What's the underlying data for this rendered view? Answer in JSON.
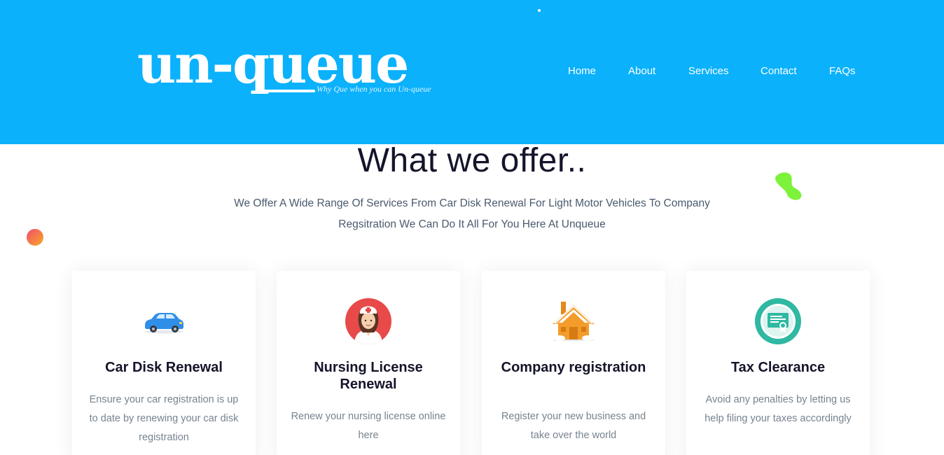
{
  "header": {
    "logo": {
      "text": "un-queue",
      "tagline": "Why Que when you can Un-queue"
    },
    "nav": [
      "Home",
      "About",
      "Services",
      "Contact",
      "FAQs"
    ]
  },
  "section": {
    "title": "What we offer..",
    "intro": "We Offer A Wide Range Of Services From Car Disk Renewal For Light Motor Vehicles To Company Regsitration We Can Do It All For You Here At Unqueue"
  },
  "services": [
    {
      "icon": "car-icon",
      "title": "Car Disk Renewal",
      "description": "Ensure your car registration is up to date by renewing your car disk registration"
    },
    {
      "icon": "nurse-icon",
      "title": "Nursing License Renewal",
      "description": "Renew your nursing license online here"
    },
    {
      "icon": "house-icon",
      "title": "Company registration",
      "description": "Register your new business and take over the world"
    },
    {
      "icon": "certificate-icon",
      "title": "Tax Clearance",
      "description": "Avoid any penalties by letting us help filing your taxes accordingly"
    }
  ],
  "colors": {
    "header_bg": "#0bb1fb",
    "heading": "#14142b",
    "body_text": "#77838f",
    "accent_green": "#7cf23a",
    "accent_orange": "#f9a825"
  }
}
